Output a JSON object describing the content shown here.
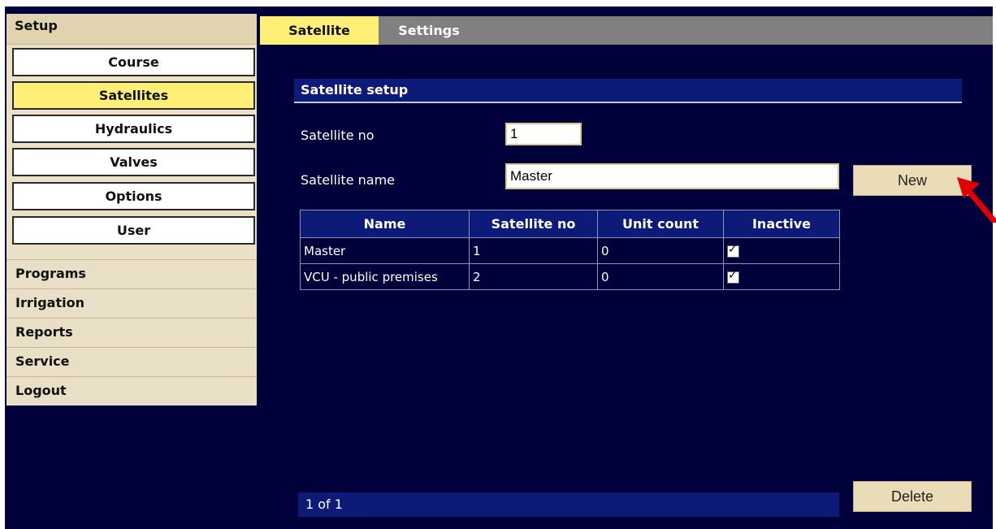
{
  "nav": {
    "header": "Setup",
    "sub_items": [
      "Course",
      "Satellites",
      "Hydraulics",
      "Valves",
      "Options",
      "User"
    ],
    "active_sub": "Satellites",
    "items": [
      "Programs",
      "Irrigation",
      "Reports",
      "Service",
      "Logout"
    ]
  },
  "tabs": {
    "active": "Satellite",
    "other": "Settings"
  },
  "section": {
    "title": "Satellite setup"
  },
  "form": {
    "satellite_no_label": "Satellite no",
    "satellite_no_value": "1",
    "satellite_name_label": "Satellite name",
    "satellite_name_value": "Master",
    "new_button": "New",
    "delete_button": "Delete"
  },
  "table": {
    "columns": [
      "Name",
      "Satellite no",
      "Unit count",
      "Inactive"
    ],
    "rows": [
      {
        "name": "Master",
        "satellite_no": "1",
        "unit_count": "0",
        "inactive": true
      },
      {
        "name": "VCU - public premises",
        "satellite_no": "2",
        "unit_count": "0",
        "inactive": true
      }
    ]
  },
  "pager": {
    "text": "1 of 1"
  },
  "colors": {
    "background": "#00003a",
    "accent": "#ffef77",
    "header_blue": "#0d1a78",
    "annotation_arrow": "#e00000"
  }
}
